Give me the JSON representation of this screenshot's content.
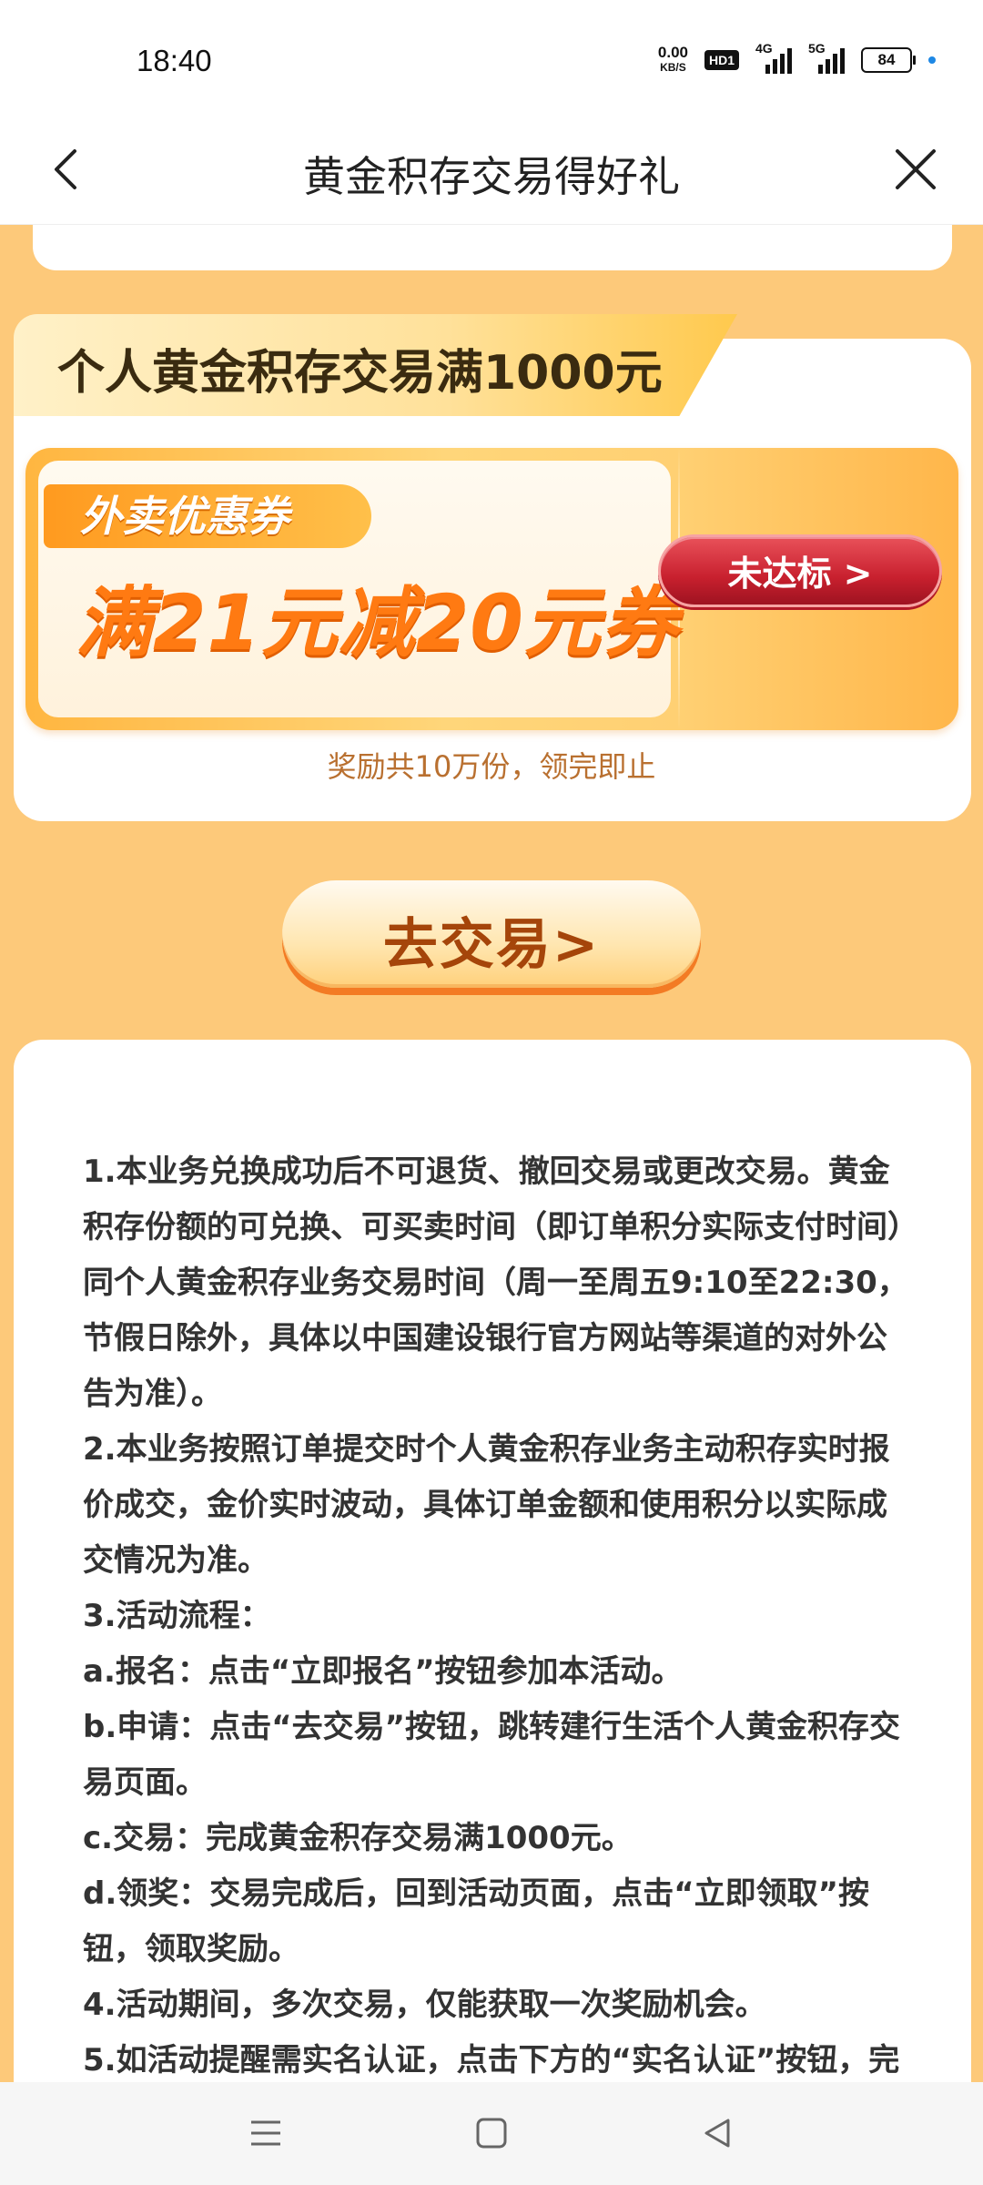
{
  "status_bar": {
    "time": "18:40",
    "net_speed_value": "0.00",
    "net_speed_unit": "KB/S",
    "hd_badge": "HD1",
    "signal_1_tag": "4G",
    "signal_2_tag": "5G",
    "battery": "84"
  },
  "nav": {
    "title": "黄金积存交易得好礼"
  },
  "reward": {
    "banner_title": "个人黄金积存交易满1000元",
    "coupon_tag": "外卖优惠券",
    "coupon_main": "满21元减20元券",
    "button_label": "未达标 >",
    "note": "奖励共10万份，领完即止"
  },
  "trade_button": {
    "label": "去交易>"
  },
  "rules": [
    "1.本业务兑换成功后不可退货、撤回交易或更改交易。黄金积存份额的可兑换、可买卖时间（即订单积分实际支付时间）同个人黄金积存业务交易时间（周一至周五9:10至22:30，节假日除外，具体以中国建设银行官方网站等渠道的对外公告为准）。",
    "2.本业务按照订单提交时个人黄金积存业务主动积存实时报价成交，金价实时波动，具体订单金额和使用积分以实际成交情况为准。",
    "3.活动流程：",
    "a.报名：点击“立即报名”按钮参加本活动。",
    "b.申请：点击“去交易”按钮，跳转建行生活个人黄金积存交易页面。",
    "c.交易：完成黄金积存交易满1000元。",
    "d.领奖：交易完成后，回到活动页面，点击“立即领取”按钮，领取奖励。",
    "4.活动期间，多次交易，仅能获取一次奖励机会。",
    "5.如活动提醒需实名认证，点击下方的“实名认证”按钮，完"
  ],
  "icons": {
    "back": "chevron-left-icon",
    "close": "close-icon",
    "sys_menu": "menu-icon",
    "sys_home": "square-home-icon",
    "sys_back": "triangle-back-icon"
  },
  "colors": {
    "page_background": "#fdc97a",
    "coupon_text": "#ff7a12",
    "button_red": "#c8202e",
    "note_text": "#b97030",
    "trade_text": "#a5450a"
  }
}
